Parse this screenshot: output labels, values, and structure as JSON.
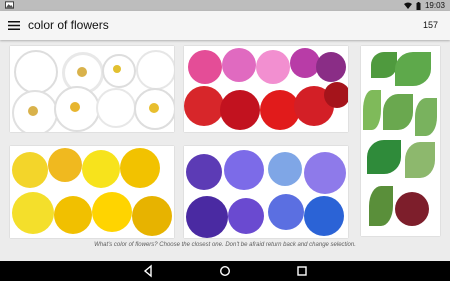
{
  "status": {
    "time": "19:03",
    "image_icon": "image-icon",
    "wifi_icon": "wifi-icon",
    "battery_icon": "battery-icon"
  },
  "appbar": {
    "title": "color of flowers",
    "count": "157",
    "menu_icon": "menu-icon"
  },
  "options": [
    {
      "name": "white",
      "color": "#ffffff"
    },
    {
      "name": "red-purple",
      "color": "#d81b60"
    },
    {
      "name": "green",
      "color": "#6aa84f"
    },
    {
      "name": "yellow",
      "color": "#f5c400"
    },
    {
      "name": "blue-violet",
      "color": "#6b5be0"
    }
  ],
  "hint": "What's color of flowers? Choose the closest one. Don't be afraid return back and change selection.",
  "nav": {
    "back_icon": "back-icon",
    "home_icon": "home-icon",
    "recents_icon": "recents-icon"
  }
}
